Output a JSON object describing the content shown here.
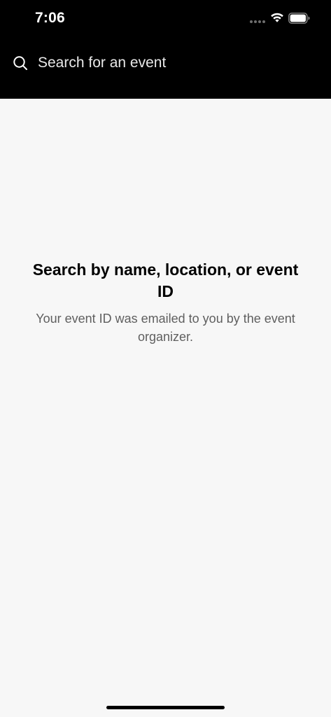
{
  "status_bar": {
    "time": "7:06",
    "icons": [
      "signal-dots-icon",
      "wifi-icon",
      "battery-icon"
    ]
  },
  "search": {
    "icon": "search-icon",
    "placeholder": "Search for an event",
    "value": ""
  },
  "empty_state": {
    "title": "Search by name, location, or event ID",
    "subtitle": "Your event ID was emailed to you by the event organizer."
  },
  "colors": {
    "header_background": "#000000",
    "page_background": "#f7f7f7",
    "title_text": "#000000",
    "subtitle_text": "#5f5f5f",
    "header_text": "#ffffff"
  }
}
